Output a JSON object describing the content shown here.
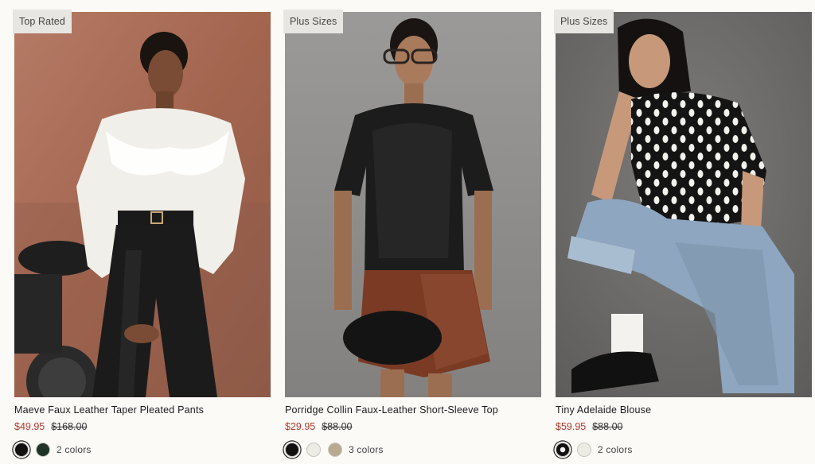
{
  "products": [
    {
      "badge": "Top Rated",
      "title": "Maeve Faux Leather Taper Pleated Pants",
      "sale_price": "$49.95",
      "original_price": "$168.00",
      "colors_label": "2 colors",
      "swatches": [
        "#111111",
        "#1f3326"
      ],
      "selected_swatch": 0,
      "image_bg": "#a86e5a"
    },
    {
      "badge": "Plus Sizes",
      "title": "Porridge Collin Faux-Leather Short-Sleeve Top",
      "sale_price": "$29.95",
      "original_price": "$88.00",
      "colors_label": "3 colors",
      "swatches": [
        "#111111",
        "#ecebe4",
        "#b8a990"
      ],
      "selected_swatch": 0,
      "image_bg": "#8f8e8c"
    },
    {
      "badge": "Plus Sizes",
      "title": "Tiny Adelaide Blouse",
      "sale_price": "$59.95",
      "original_price": "$88.00",
      "colors_label": "2 colors",
      "swatches": [
        "#111111",
        "#ecebe4"
      ],
      "selected_swatch": 0,
      "image_bg": "#6f6e6c"
    }
  ]
}
